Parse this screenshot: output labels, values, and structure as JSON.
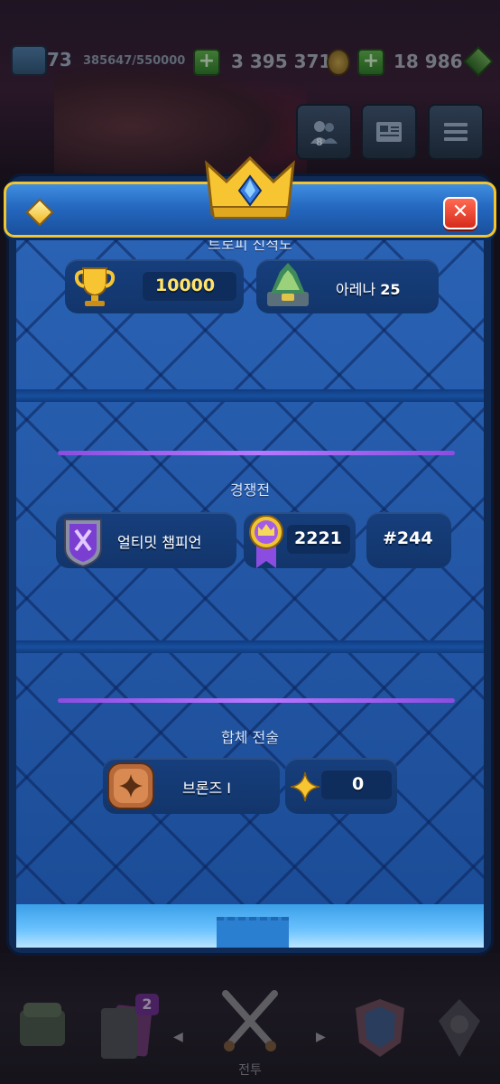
{
  "topbar": {
    "level": "73",
    "xp": "385647/550000",
    "gold": "3 395 371",
    "gems": "18 986",
    "plus_symbol": "+"
  },
  "menu": {
    "friends_count": "8"
  },
  "modal": {
    "close_symbol": "✕",
    "trophy_section": {
      "title": "트로피 진척도",
      "trophies": "10000",
      "arena_label": "아레나",
      "arena_number": "25"
    },
    "ranked_section": {
      "title": "경쟁전",
      "league_name": "얼티밋 챔피언",
      "rating": "2221",
      "rank": "#244"
    },
    "merge_section": {
      "title": "합체 전술",
      "league_name": "브론즈 I",
      "stars": "0"
    }
  },
  "bottom_nav": {
    "cards_badge": "2",
    "battle_label": "전투"
  },
  "colors": {
    "modal_border": "#f0c531",
    "header_blue": "#2468c0",
    "content_blue": "#1d4f9a",
    "purple_accent": "#b678ff",
    "close_red": "#d62b1c",
    "gold_text": "#ffe36a"
  }
}
